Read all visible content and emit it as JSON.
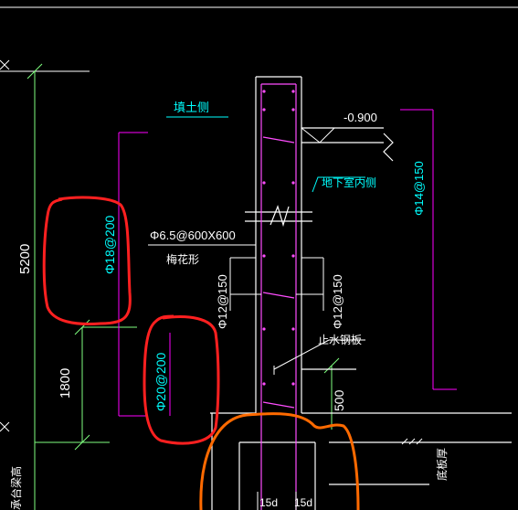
{
  "drawing": {
    "labels": {
      "fill_side": "填土侧",
      "elevation": "-0.900",
      "basement_inner_side": "地下室内侧",
      "horizontal_bar_right": "Φ14@150",
      "tie_spec": "Φ6.5@600X600",
      "tie_pattern": "梅花形",
      "dim_total": "5200",
      "dim_lower": "1800",
      "bar_upper_left": "Φ18@200",
      "bar_lower_left": "Φ20@200",
      "vertical_bar_left": "Φ12@150",
      "vertical_bar_right": "Φ12@150",
      "waterstop": "止水钢板",
      "dim_500": "500",
      "cap_beam_height": "承台梁高",
      "base_thickness": "底板厚",
      "anchor_left": "15d",
      "anchor_right": "15d"
    },
    "colors": {
      "background": "#000000",
      "line_white": "#ffffff",
      "cyan_text": "#00ffff",
      "magenta": "#ff00ff",
      "green_dim": "#7fff7f",
      "rebar_magenta": "#ff4dff",
      "markup_red": "#ff2020",
      "markup_orange": "#ff6a00"
    }
  }
}
